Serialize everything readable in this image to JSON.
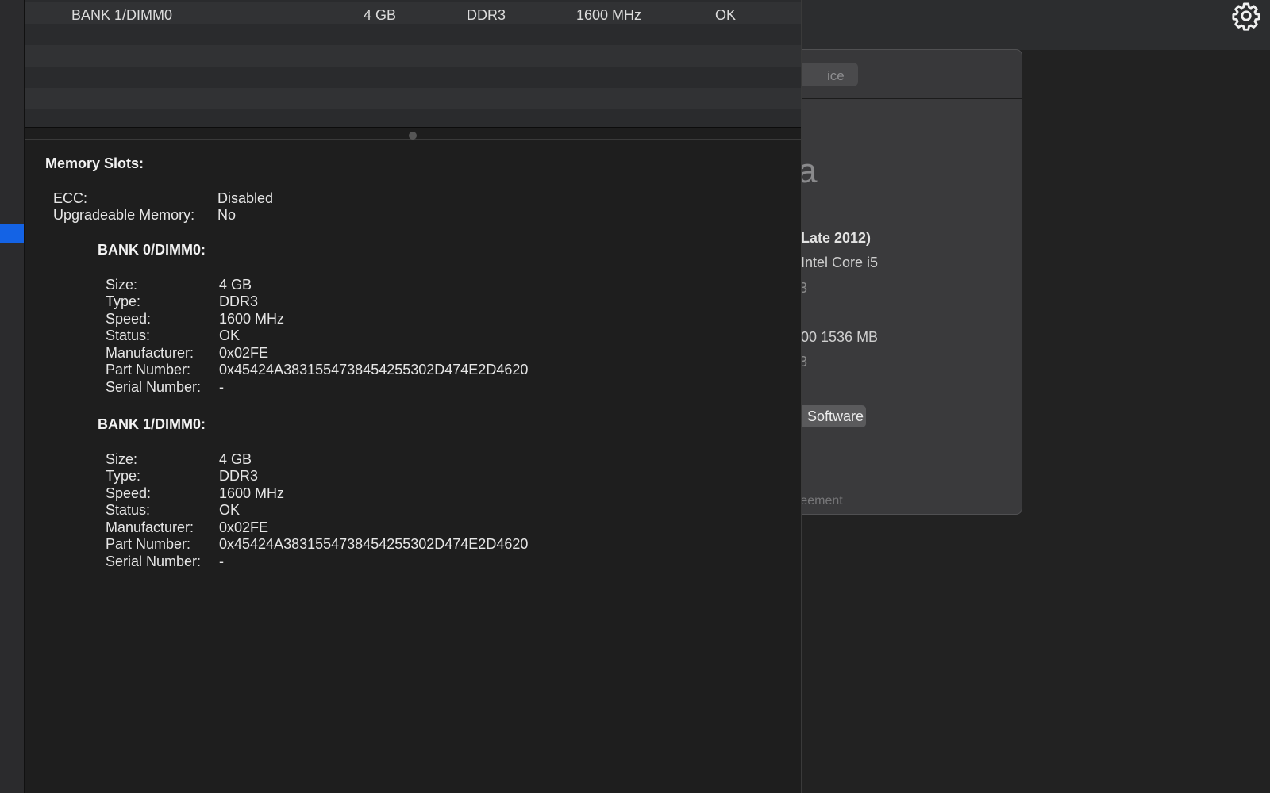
{
  "memory_table": {
    "rows": [
      {
        "slot": "BANK 1/DIMM0",
        "size": "4 GB",
        "type": "DDR3",
        "speed": "1600 MHz",
        "status": "OK"
      }
    ]
  },
  "detail": {
    "heading": "Memory Slots:",
    "general": [
      {
        "label": "ECC:",
        "value": "Disabled"
      },
      {
        "label": "Upgradeable Memory:",
        "value": "No"
      }
    ],
    "banks": [
      {
        "title": "BANK 0/DIMM0:",
        "fields": [
          {
            "label": "Size:",
            "value": "4 GB"
          },
          {
            "label": "Type:",
            "value": "DDR3"
          },
          {
            "label": "Speed:",
            "value": "1600 MHz"
          },
          {
            "label": "Status:",
            "value": "OK"
          },
          {
            "label": "Manufacturer:",
            "value": "0x02FE"
          },
          {
            "label": "Part Number:",
            "value": "0x45424A3831554738454255302D474E2D4620"
          },
          {
            "label": "Serial Number:",
            "value": "-"
          }
        ]
      },
      {
        "title": "BANK 1/DIMM0:",
        "fields": [
          {
            "label": "Size:",
            "value": "4 GB"
          },
          {
            "label": "Type:",
            "value": "DDR3"
          },
          {
            "label": "Speed:",
            "value": "1600 MHz"
          },
          {
            "label": "Status:",
            "value": "OK"
          },
          {
            "label": "Manufacturer:",
            "value": "0x02FE"
          },
          {
            "label": "Part Number:",
            "value": "0x45424A3831554738454255302D474E2D4620"
          },
          {
            "label": "Serial Number:",
            "value": "-"
          }
        ]
      }
    ]
  },
  "about_window": {
    "tab_fragment": "ice",
    "name_fragment": "a",
    "model_fragment": "Late 2012)",
    "processor_fragment": "Intel Core i5",
    "memory_fragment": "3",
    "graphics_fragment": "00 1536 MB",
    "disk_fragment": "3",
    "update_button": "Software Update...",
    "footer_fragment": "reement"
  },
  "icons": {
    "settings": "gear-icon"
  },
  "colors": {
    "selection": "#1463e5",
    "window_bg": "#1e1e1e"
  }
}
